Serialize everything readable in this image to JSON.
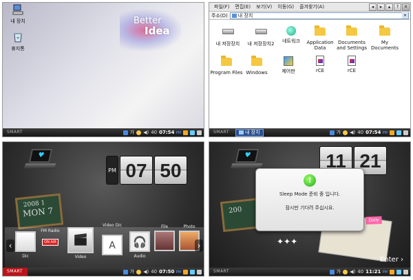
{
  "colors": {
    "taskbar": "#1e1e1e",
    "start_red": "#b8151a",
    "time_ampm": "#6aa0ff"
  },
  "taskbar": {
    "start": "SMART",
    "lang": "가",
    "volume": "40"
  },
  "panel1": {
    "time": "07:54",
    "ampm": "PM",
    "icons": [
      {
        "label": "내 장치",
        "icon": "computer-icon"
      },
      {
        "label": "휴지통",
        "icon": "recycle-bin-icon"
      }
    ],
    "logo_line1": "Better",
    "logo_line2": "Idea"
  },
  "panel2": {
    "time": "07:54",
    "ampm": "PM",
    "task_label": "내 장치",
    "menu": [
      "파일(F)",
      "편집(E)",
      "보기(V)",
      "이동(G)",
      "즐겨찾기(A)"
    ],
    "window_buttons": [
      "back-icon",
      "forward-icon",
      "up-icon",
      "help",
      "close"
    ],
    "help_label": "?",
    "close_label": "✕",
    "address_label": "주소(D)",
    "address_value": "내 장치",
    "files": [
      {
        "label": "내 저장장치",
        "icon": "drive-icon"
      },
      {
        "label": "내 저장장치2",
        "icon": "drive-icon"
      },
      {
        "label": "네트워크",
        "icon": "network-icon"
      },
      {
        "label": "Application Data",
        "icon": "folder-icon"
      },
      {
        "label": "Documents and Settings",
        "icon": "folder-icon"
      },
      {
        "label": "My Documents",
        "icon": "folder-icon"
      },
      {
        "label": "Program Files",
        "icon": "folder-icon"
      },
      {
        "label": "Windows",
        "icon": "folder-icon"
      },
      {
        "label": "제어판",
        "icon": "control-panel-icon"
      },
      {
        "label": "rCE",
        "icon": "rce-icon"
      },
      {
        "label": "rCE",
        "icon": "rce-icon"
      }
    ]
  },
  "panel3": {
    "time": "07:50",
    "ampm": "PM",
    "clock_ampm": "PM",
    "clock_hour": "07",
    "clock_min": "50",
    "board_text1": "2008",
    "board_text2": "1",
    "board_text3": "MON 7",
    "media": {
      "labels": [
        "Dic",
        "FM Radio",
        "Video",
        "Video Dic",
        "Audio",
        "File",
        "Photo"
      ],
      "onair": "ON AIR"
    }
  },
  "panel4": {
    "time": "11:21",
    "ampm": "PM",
    "clock_hour": "11",
    "clock_min": "21",
    "board_text1": "200",
    "dialog_line1": "Sleep Mode 준비 중 입니다.",
    "dialog_line2": "잠시만 기다려 주십시요.",
    "enter_label": "Enter",
    "note": "Daily"
  }
}
